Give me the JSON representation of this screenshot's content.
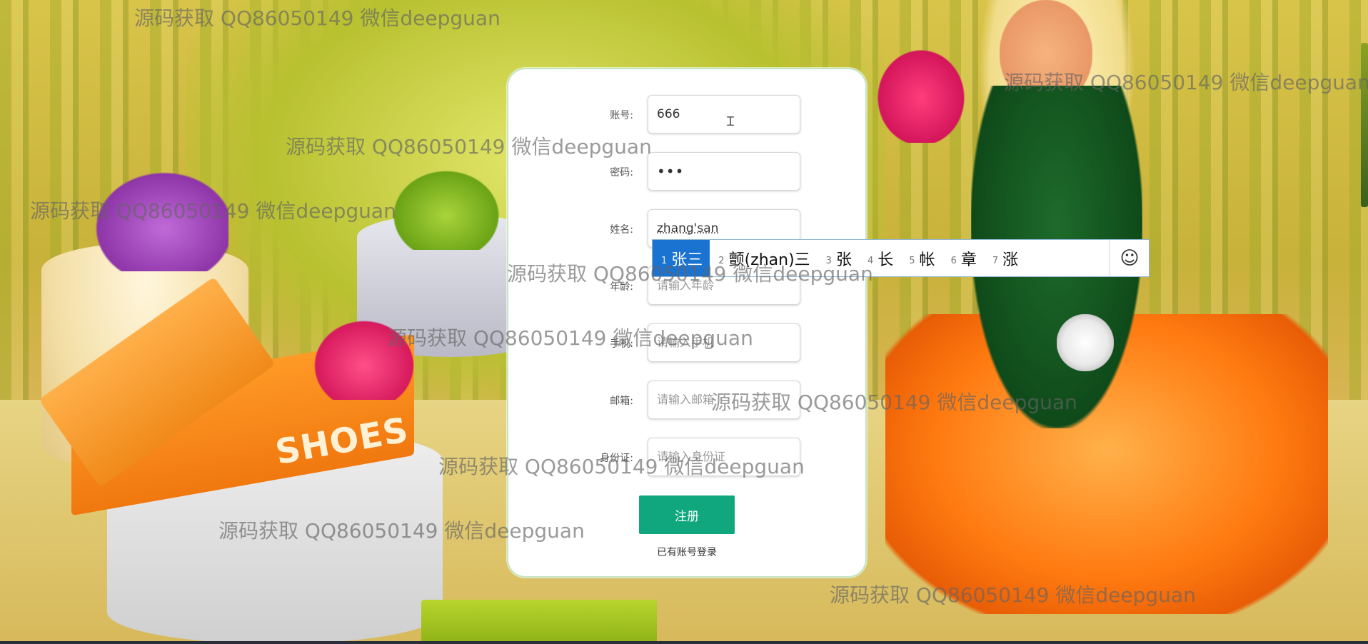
{
  "form": {
    "fields": [
      {
        "label": "账号:",
        "value": "666",
        "placeholder": "",
        "type": "text"
      },
      {
        "label": "密码:",
        "value": "•••",
        "placeholder": "",
        "type": "password"
      },
      {
        "label": "姓名:",
        "value": "zhang'san",
        "placeholder": "",
        "type": "text"
      },
      {
        "label": "年龄:",
        "value": "",
        "placeholder": "请输入年龄",
        "type": "text"
      },
      {
        "label": "手机:",
        "value": "",
        "placeholder": "请输入手机",
        "type": "text"
      },
      {
        "label": "邮箱:",
        "value": "",
        "placeholder": "请输入邮箱",
        "type": "text"
      },
      {
        "label": "身份证:",
        "value": "",
        "placeholder": "请输入身份证",
        "type": "text"
      }
    ],
    "submit_label": "注册",
    "login_link": "已有账号登录"
  },
  "ime": {
    "candidates": [
      {
        "num": "1",
        "text": "张三",
        "selected": true
      },
      {
        "num": "2",
        "text": "颤(zhan)三",
        "selected": false
      },
      {
        "num": "3",
        "text": "张",
        "selected": false
      },
      {
        "num": "4",
        "text": "长",
        "selected": false
      },
      {
        "num": "5",
        "text": "帐",
        "selected": false
      },
      {
        "num": "6",
        "text": "章",
        "selected": false
      },
      {
        "num": "7",
        "text": "涨",
        "selected": false
      }
    ],
    "emoji": "☺",
    "accent": "#1a73d1"
  },
  "background": {
    "box_label": "SHOES"
  },
  "watermark_text": "源码获取 QQ86050149 微信deepguan",
  "colors": {
    "submit": "#10a77f"
  }
}
